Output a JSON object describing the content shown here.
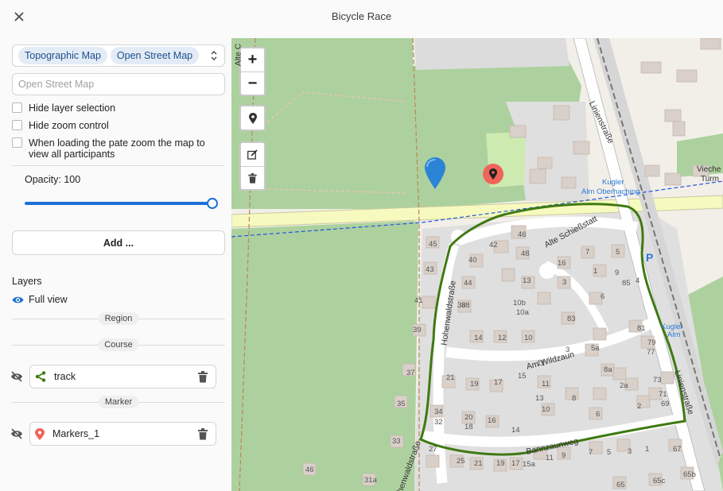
{
  "window": {
    "title": "Bicycle Race",
    "close_icon": "close-icon"
  },
  "layer_select": {
    "chips": [
      "Topographic Map",
      "Open Street Map"
    ]
  },
  "layer_name_input": {
    "placeholder": "Open Street Map",
    "value": ""
  },
  "options": {
    "hide_layer_selection": "Hide layer selection",
    "hide_zoom_control": "Hide zoom control",
    "zoom_on_load_line1": "When loading the pate zoom the map to",
    "zoom_on_load_line2": "view all participants"
  },
  "opacity": {
    "label": "Opacity: 100",
    "value": 100
  },
  "add_button": "Add ...",
  "layers": {
    "title": "Layers",
    "full_view": "Full view",
    "groups": {
      "region": "Region",
      "course": "Course",
      "marker": "Marker"
    },
    "items": [
      {
        "name": "track",
        "icon": "route-icon"
      },
      {
        "name": "Markers_1",
        "icon": "map-pin-icon"
      }
    ]
  },
  "map": {
    "zoom_in": "+",
    "zoom_out": "−",
    "street_labels": {
      "linienstrasse_top": "Linienstraße",
      "linienstrasse_bottom": "Linienstraße",
      "alte_schiessstatt": "Alte Schießstatt",
      "am_wildzaun": "Am Wildzaun",
      "hohenwaldstrasse_mid": "Hohenwaldstraße",
      "hohenwaldstrasse_bottom": "Hohenwaldstraße",
      "bannzaunweg": "Bannzaunweg",
      "alte_c": "Alte C"
    },
    "poi_labels": {
      "kugler_alm_oberhaching_1": "Kugler",
      "kugler_alm_oberhaching_2": "Alm Oberhaching",
      "kugler_alm_1": "Kugler",
      "kugler_alm_2": "Alm",
      "vieche_1": "Vieche",
      "vieche_2": "Turm",
      "parking": "P"
    },
    "house_numbers": [
      "45",
      "42",
      "46",
      "48",
      "43",
      "40",
      "44",
      "38",
      "41",
      "36",
      "39",
      "14",
      "12",
      "10",
      "13",
      "16",
      "7",
      "5",
      "1",
      "3",
      "9",
      "85",
      "83",
      "6",
      "4",
      "81",
      "79",
      "77",
      "73",
      "71",
      "69",
      "2",
      "2a",
      "5a",
      "3",
      "8a",
      "8",
      "6",
      "10",
      "11",
      "10b",
      "10a",
      "13",
      "11",
      "15",
      "17",
      "19",
      "21",
      "37",
      "35",
      "34",
      "32",
      "20",
      "18",
      "16",
      "14",
      "33",
      "27",
      "25",
      "21",
      "19",
      "17",
      "15a",
      "11",
      "9",
      "7",
      "5",
      "3",
      "1",
      "46",
      "31a",
      "67",
      "65",
      "65c",
      "65b",
      "63"
    ]
  },
  "colors": {
    "accent": "#1c71d8",
    "track": "#3f7a12",
    "marker_red": "#f0645a",
    "marker_blue": "#2b84d6"
  }
}
